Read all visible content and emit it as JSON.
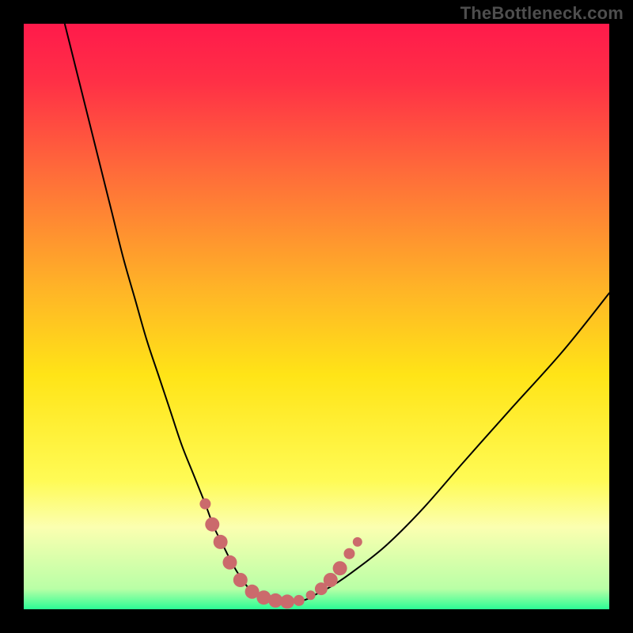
{
  "watermark": "TheBottleneck.com",
  "chart_data": {
    "type": "line",
    "title": "",
    "xlabel": "",
    "ylabel": "",
    "xlim": [
      0,
      100
    ],
    "ylim": [
      0,
      100
    ],
    "background_gradient": {
      "stops": [
        {
          "offset": 0.0,
          "color": "#ff1a4b"
        },
        {
          "offset": 0.1,
          "color": "#ff3046"
        },
        {
          "offset": 0.25,
          "color": "#ff6a3a"
        },
        {
          "offset": 0.45,
          "color": "#ffb327"
        },
        {
          "offset": 0.6,
          "color": "#ffe417"
        },
        {
          "offset": 0.78,
          "color": "#fffb55"
        },
        {
          "offset": 0.86,
          "color": "#fbffb0"
        },
        {
          "offset": 0.965,
          "color": "#b9ffa6"
        },
        {
          "offset": 1.0,
          "color": "#2bfd95"
        }
      ]
    },
    "series": [
      {
        "name": "bottleneck-curve",
        "x": [
          7,
          9,
          11,
          13,
          15,
          17,
          19,
          21,
          23,
          25,
          27,
          29,
          31,
          32.5,
          34,
          35.5,
          37,
          38.5,
          40,
          42,
          45,
          48,
          50,
          53,
          57,
          62,
          68,
          75,
          83,
          92,
          100
        ],
        "y": [
          100,
          92,
          84,
          76,
          68,
          60,
          53,
          46,
          40,
          34,
          28,
          23,
          18,
          14,
          11,
          8,
          5.5,
          3.5,
          2.2,
          1.4,
          1.2,
          1.6,
          2.6,
          4.2,
          7,
          11,
          17,
          25,
          34,
          44,
          54
        ]
      }
    ],
    "markers": {
      "color": "#cb6a6c",
      "radius_sequence": [
        7,
        9,
        9,
        9,
        9,
        9,
        9,
        9,
        9,
        7,
        6,
        8,
        9,
        9,
        7,
        6
      ],
      "points": [
        {
          "x": 31.0,
          "y": 18.0
        },
        {
          "x": 32.2,
          "y": 14.5
        },
        {
          "x": 33.6,
          "y": 11.5
        },
        {
          "x": 35.2,
          "y": 8.0
        },
        {
          "x": 37.0,
          "y": 5.0
        },
        {
          "x": 39.0,
          "y": 3.0
        },
        {
          "x": 41.0,
          "y": 2.0
        },
        {
          "x": 43.0,
          "y": 1.5
        },
        {
          "x": 45.0,
          "y": 1.3
        },
        {
          "x": 47.0,
          "y": 1.5
        },
        {
          "x": 49.0,
          "y": 2.4
        },
        {
          "x": 50.8,
          "y": 3.5
        },
        {
          "x": 52.4,
          "y": 5.0
        },
        {
          "x": 54.0,
          "y": 7.0
        },
        {
          "x": 55.6,
          "y": 9.5
        },
        {
          "x": 57.0,
          "y": 11.5
        }
      ]
    }
  }
}
